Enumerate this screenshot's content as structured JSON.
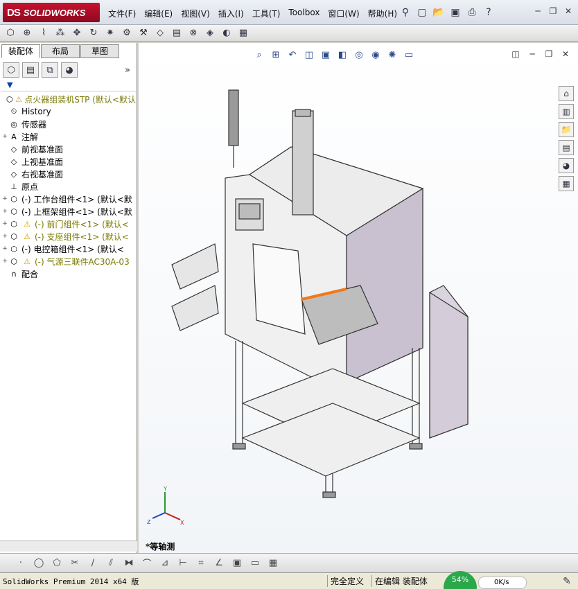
{
  "app": {
    "logo_text": "SOLIDWORKS",
    "logo_mark": "DS"
  },
  "menu": [
    "文件(F)",
    "编辑(E)",
    "视图(V)",
    "插入(I)",
    "工具(T)",
    "Toolbox",
    "窗口(W)",
    "帮助(H)"
  ],
  "title_tools": [
    "pin-icon",
    "new-document-icon",
    "open-icon",
    "save-icon",
    "print-icon",
    "help-icon"
  ],
  "window_buttons": [
    "minimize",
    "restore",
    "close"
  ],
  "toolbar_icons": [
    "assembly-icon",
    "insert-component-icon",
    "mate-icon",
    "pattern-icon",
    "move-component-icon",
    "rotate-icon",
    "explode-icon",
    "toolbox-icon",
    "smart-fastener-icon",
    "reference-geometry-icon",
    "bom-icon",
    "interference-icon",
    "simulation-icon",
    "display-icon",
    "instant3d-icon"
  ],
  "left_tabs": [
    "装配体",
    "布局",
    "草图"
  ],
  "feature_tree": [
    {
      "label": "点火器组装机STP  (默认<默认",
      "exp": "",
      "icon": "assembly",
      "warn": true,
      "color": "#7a7a00"
    },
    {
      "label": "History",
      "exp": "",
      "icon": "history",
      "warn": false,
      "color": "#000"
    },
    {
      "label": "传感器",
      "exp": "",
      "icon": "sensor",
      "warn": false,
      "color": "#000"
    },
    {
      "label": "注解",
      "exp": "+",
      "icon": "annotation",
      "warn": false,
      "color": "#000"
    },
    {
      "label": "前视基准面",
      "exp": "",
      "icon": "plane",
      "warn": false,
      "color": "#000"
    },
    {
      "label": "上视基准面",
      "exp": "",
      "icon": "plane",
      "warn": false,
      "color": "#000"
    },
    {
      "label": "右视基准面",
      "exp": "",
      "icon": "plane",
      "warn": false,
      "color": "#000"
    },
    {
      "label": "原点",
      "exp": "",
      "icon": "origin",
      "warn": false,
      "color": "#000"
    },
    {
      "label": "(-) 工作台组件<1> (默认<默",
      "exp": "+",
      "icon": "assembly",
      "warn": false,
      "color": "#000"
    },
    {
      "label": "(-) 上框架组件<1> (默认<默",
      "exp": "+",
      "icon": "assembly",
      "warn": false,
      "color": "#000"
    },
    {
      "label": "(-) 前门组件<1> (默认<",
      "exp": "+",
      "icon": "assembly",
      "warn": true,
      "color": "#7a7a00"
    },
    {
      "label": "(-) 支座组件<1> (默认<",
      "exp": "+",
      "icon": "assembly",
      "warn": true,
      "color": "#7a7a00"
    },
    {
      "label": "(-) 电控箱组件<1> (默认<",
      "exp": "+",
      "icon": "assembly",
      "warn": false,
      "color": "#000"
    },
    {
      "label": "(-) 气源三联件AC30A-03",
      "exp": "+",
      "icon": "assembly",
      "warn": true,
      "color": "#7a7a00"
    },
    {
      "label": "配合",
      "exp": "",
      "icon": "mates",
      "warn": false,
      "color": "#000"
    }
  ],
  "viewport": {
    "view_name": "*等轴测",
    "axes": {
      "x": "X",
      "y": "Y",
      "z": "Z"
    }
  },
  "status": {
    "product": "SolidWorks Premium 2014 x64 版",
    "definition": "完全定义",
    "editing": "在编辑 装配体",
    "cpu": "54%",
    "net": "0K/s"
  }
}
